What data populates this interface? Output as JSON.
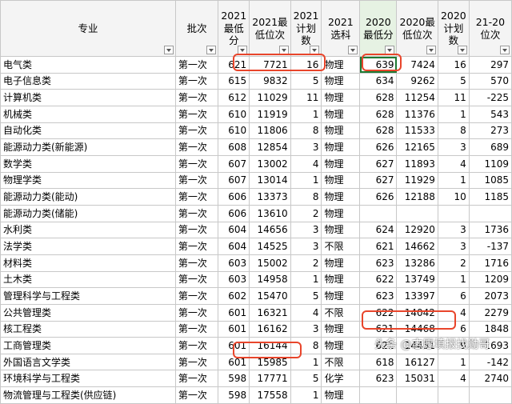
{
  "sheet": {
    "headers": [
      {
        "label": "专业"
      },
      {
        "label": "批次"
      },
      {
        "label": "2021最低分"
      },
      {
        "label": "2021最低位次"
      },
      {
        "label": "2021计划数"
      },
      {
        "label": "2021选科"
      },
      {
        "label": "2020最低分"
      },
      {
        "label": "2020最低位次"
      },
      {
        "label": "2020计划数"
      },
      {
        "label": "21-20位次"
      }
    ],
    "rows": [
      [
        "电气类",
        "第一次",
        "621",
        "7721",
        "16",
        "物理",
        "639",
        "7424",
        "16",
        "297"
      ],
      [
        "电子信息类",
        "第一次",
        "615",
        "9832",
        "5",
        "物理",
        "634",
        "9262",
        "5",
        "570"
      ],
      [
        "计算机类",
        "第一次",
        "612",
        "11029",
        "11",
        "物理",
        "628",
        "11254",
        "11",
        "-225"
      ],
      [
        "机械类",
        "第一次",
        "610",
        "11919",
        "1",
        "物理",
        "628",
        "11376",
        "1",
        "543"
      ],
      [
        "自动化类",
        "第一次",
        "610",
        "11806",
        "8",
        "物理",
        "628",
        "11533",
        "8",
        "273"
      ],
      [
        "能源动力类(新能源)",
        "第一次",
        "608",
        "12854",
        "3",
        "物理",
        "626",
        "12165",
        "3",
        "689"
      ],
      [
        "数学类",
        "第一次",
        "607",
        "13002",
        "4",
        "物理",
        "627",
        "11893",
        "4",
        "1109"
      ],
      [
        "物理学类",
        "第一次",
        "607",
        "13014",
        "1",
        "物理",
        "627",
        "11929",
        "1",
        "1085"
      ],
      [
        "能源动力类(能动)",
        "第一次",
        "606",
        "13373",
        "8",
        "物理",
        "626",
        "12188",
        "10",
        "1185"
      ],
      [
        "能源动力类(储能)",
        "第一次",
        "606",
        "13610",
        "2",
        "物理",
        "",
        "",
        "",
        ""
      ],
      [
        "水利类",
        "第一次",
        "604",
        "14656",
        "3",
        "物理",
        "624",
        "12920",
        "3",
        "1736"
      ],
      [
        "法学类",
        "第一次",
        "604",
        "14525",
        "3",
        "不限",
        "621",
        "14662",
        "3",
        "-137"
      ],
      [
        "材料类",
        "第一次",
        "603",
        "15002",
        "2",
        "物理",
        "623",
        "13286",
        "2",
        "1716"
      ],
      [
        "土木类",
        "第一次",
        "603",
        "14958",
        "1",
        "物理",
        "622",
        "13749",
        "1",
        "1209"
      ],
      [
        "管理科学与工程类",
        "第一次",
        "602",
        "15470",
        "5",
        "物理",
        "623",
        "13397",
        "6",
        "2073"
      ],
      [
        "公共管理类",
        "第一次",
        "601",
        "16321",
        "4",
        "不限",
        "622",
        "14042",
        "4",
        "2279"
      ],
      [
        "核工程类",
        "第一次",
        "601",
        "16162",
        "3",
        "物理",
        "621",
        "14468",
        "6",
        "1848"
      ],
      [
        "工商管理类",
        "第一次",
        "601",
        "16144",
        "8",
        "物理",
        "621",
        "14451",
        "9",
        "1693"
      ],
      [
        "外国语言文学类",
        "第一次",
        "601",
        "15985",
        "1",
        "不限",
        "618",
        "16127",
        "1",
        "-142"
      ],
      [
        "环境科学与工程类",
        "第一次",
        "598",
        "17771",
        "5",
        "化学",
        "623",
        "15031",
        "4",
        "2740"
      ],
      [
        "物流管理与工程类(供应链)",
        "第一次",
        "598",
        "17558",
        "1",
        "物理",
        "",
        "",
        "",
        ""
      ]
    ]
  },
  "watermark": "头条 @志愿填报找勋哥",
  "colors": {
    "highlight_border": "#e8452b",
    "selected_cell_border": "#1e7b34",
    "header_bg": "#f4f4f4",
    "selected_header_bg": "#e6f2e3"
  }
}
